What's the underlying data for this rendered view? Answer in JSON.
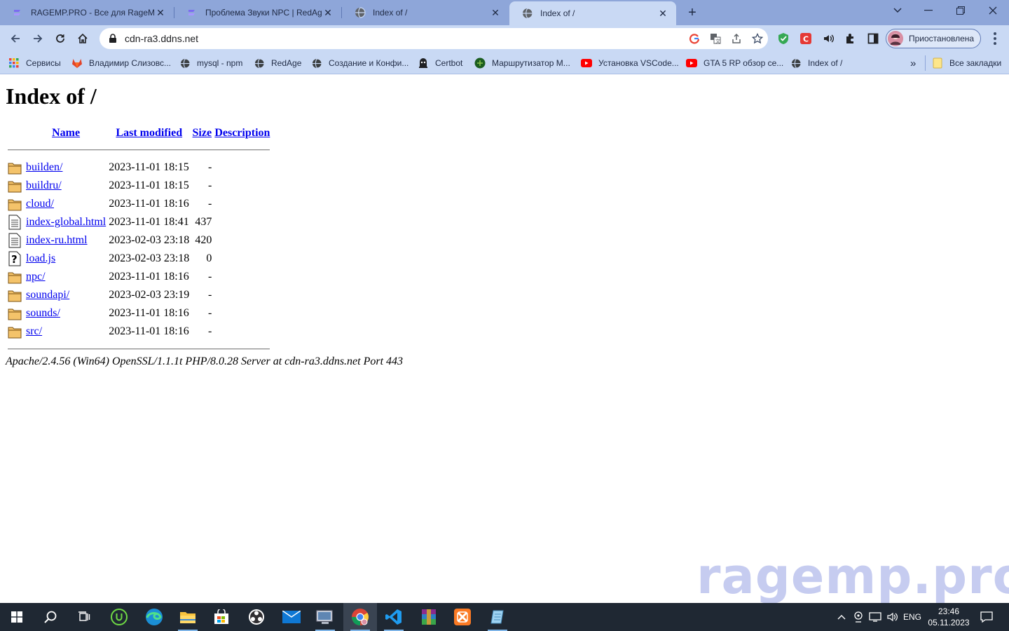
{
  "browser": {
    "tabs": [
      {
        "title": "RAGEMP.PRO - Все для RageMP",
        "active": false,
        "icon": "ragemp-icon"
      },
      {
        "title": "Проблема Звуки NPC | RedAge",
        "active": false,
        "icon": "ragemp-icon"
      },
      {
        "title": "Index of /",
        "active": false,
        "icon": "globe-icon"
      },
      {
        "title": "Index of /",
        "active": true,
        "icon": "globe-icon"
      }
    ],
    "address": "cdn-ra3.ddns.net",
    "profile_label": "Приостановлена",
    "bookmarks": [
      {
        "label": "Сервисы",
        "icon": "apps-grid-icon"
      },
      {
        "label": "Владимир Слизовс...",
        "icon": "gitlab-icon"
      },
      {
        "label": "mysql - npm",
        "icon": "globe-icon"
      },
      {
        "label": "RedAge",
        "icon": "globe-icon"
      },
      {
        "label": "Создание и Конфи...",
        "icon": "globe-icon"
      },
      {
        "label": "Certbot",
        "icon": "certbot-icon"
      },
      {
        "label": "Маршрутизатор M...",
        "icon": "router-icon"
      },
      {
        "label": "Установка VSCode...",
        "icon": "youtube-icon"
      },
      {
        "label": "GTA 5 RP обзор се...",
        "icon": "youtube-icon"
      },
      {
        "label": "Index of /",
        "icon": "globe-icon"
      }
    ],
    "overflow_label": "»",
    "all_bookmarks_label": "Все закладки"
  },
  "listing": {
    "heading": "Index of /",
    "columns": {
      "name": "Name",
      "modified": "Last modified",
      "size": "Size",
      "description": "Description"
    },
    "rows": [
      {
        "type": "folder",
        "name": "builden/",
        "modified": "2023-11-01 18:15",
        "size": "-",
        "description": ""
      },
      {
        "type": "folder",
        "name": "buildru/",
        "modified": "2023-11-01 18:15",
        "size": "-",
        "description": ""
      },
      {
        "type": "folder",
        "name": "cloud/",
        "modified": "2023-11-01 18:16",
        "size": "-",
        "description": ""
      },
      {
        "type": "text",
        "name": "index-global.html",
        "modified": "2023-11-01 18:41",
        "size": "437",
        "description": ""
      },
      {
        "type": "text",
        "name": "index-ru.html",
        "modified": "2023-02-03 23:18",
        "size": "420",
        "description": ""
      },
      {
        "type": "unknown",
        "name": "load.js",
        "modified": "2023-02-03 23:18",
        "size": "0",
        "description": ""
      },
      {
        "type": "folder",
        "name": "npc/",
        "modified": "2023-11-01 18:16",
        "size": "-",
        "description": ""
      },
      {
        "type": "folder",
        "name": "soundapi/",
        "modified": "2023-02-03 23:19",
        "size": "-",
        "description": ""
      },
      {
        "type": "folder",
        "name": "sounds/",
        "modified": "2023-11-01 18:16",
        "size": "-",
        "description": ""
      },
      {
        "type": "folder",
        "name": "src/",
        "modified": "2023-11-01 18:16",
        "size": "-",
        "description": ""
      }
    ],
    "server_signature": "Apache/2.4.56 (Win64) OpenSSL/1.1.1t PHP/8.0.28 Server at cdn-ra3.ddns.net Port 443"
  },
  "watermark": "ragemp.pro",
  "taskbar": {
    "apps": [
      "windows-start-icon",
      "search-icon",
      "task-view-icon",
      "upwork-icon",
      "edge-icon",
      "file-explorer-icon",
      "store-icon",
      "obs-icon",
      "mail-icon",
      "remote-desktop-icon",
      "chrome-icon",
      "vscode-icon",
      "winrar-icon",
      "xampp-icon",
      "notepad-icon"
    ],
    "language": "ENG",
    "time": "23:46",
    "date": "05.11.2023"
  },
  "colors": {
    "tabstrip": "#8ea6d9",
    "toolbar": "#c9d9f4",
    "link": "#0000ee",
    "taskbar": "#1f2833",
    "watermark": "#c6ccf0"
  }
}
